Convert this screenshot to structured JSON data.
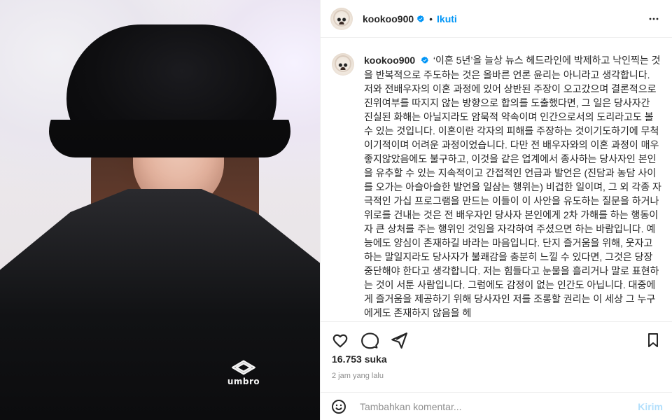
{
  "post": {
    "username": "kookoo900",
    "follow_label": "Ikuti",
    "caption": "‘이혼 5년’을 늘상 뉴스 헤드라인에 박제하고 낙인찍는 것을 반복적으로 주도하는 것은 올바른 언론 윤리는 아니라고 생각합니다. 저와 전배우자의 이혼 과정에 있어 상반된 주장이 오고갔으며 결론적으로 진위여부를 따지지 않는 방향으로 합의를 도출했다면, 그 일은 당사자간 진실된 화해는 아닐지라도 암묵적 약속이며 인간으로서의 도리라고도 볼 수 있는 것입니다. 이혼이란 각자의 피해를 주장하는 것이기도하기에 무척 이기적이며 어려운 과정이었습니다. 다만 전 배우자와의 이혼 과정이 매우 좋지않았음에도 불구하고, 이것을 같은 업계에서 종사하는 당사자인 본인을 유추할 수 있는 지속적이고 간접적인 언급과 발언은 (진담과 농담 사이를 오가는 아슬아슬한 발언을 일삼는 행위는) 비겁한 일이며, 그 외 각종 자극적인 가십 프로그램을 만드는 이들이 이 사안을 유도하는 질문을 하거나 위로를 건내는 것은 전 배우자인 당사자 본인에게 2차 가해를 하는 행동이자 큰 상처를 주는 행위인 것임을 자각하여 주셨으면 하는 바람입니다. 예능에도 양심이 존재하길 바라는 마음입니다. 단지 즐거움을 위해, 웃자고 하는 말일지라도 당사자가 불쾌감을 충분히 느낄 수 있다면, 그것은 당장 중단해야 한다고 생각합니다. 저는 힘들다고 눈물을 흘리거나 말로 표현하는 것이 서툰 사람입니다. 그럼에도 감정이 없는 인간도 아닙니다. 대중에게 즐거움을 제공하기 위해 당사자인 저를 조롱할 권리는 이 세상 그 누구에게도 존재하지 않음을 헤",
    "likes": "16.753 suka",
    "time_ago": "2 jam yang lalu",
    "comment_placeholder": "Tambahkan komentar...",
    "send_label": "Kirim"
  },
  "photo": {
    "brand_text": "umbro"
  },
  "icons": {
    "more": "more-icon",
    "verified": "verified-icon",
    "like": "heart-icon",
    "comment": "comment-icon",
    "share": "paper-plane-icon",
    "save": "bookmark-icon",
    "emoji": "smiley-icon"
  },
  "colors": {
    "accent": "#0095f6",
    "text": "#262626",
    "secondary_text": "#8e8e8e",
    "divider": "#efefef",
    "send_disabled": "#b2dffc"
  }
}
